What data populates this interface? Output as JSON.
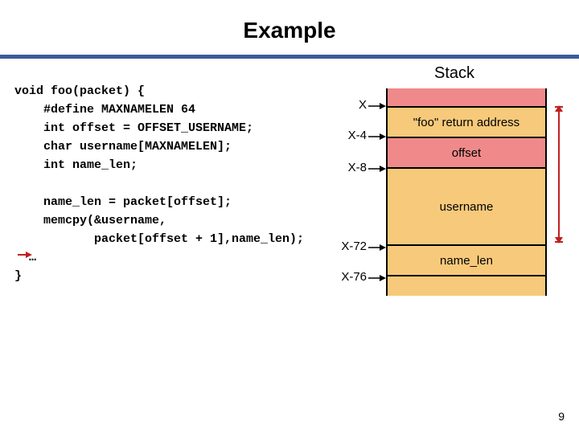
{
  "title": "Example",
  "code": {
    "l1": "void foo(packet) {",
    "l2": "    #define MAXNAMELEN 64",
    "l3": "    int offset = OFFSET_USERNAME;",
    "l4": "    char username[MAXNAMELEN];",
    "l5": "    int name_len;",
    "l6": "",
    "l7": "    name_len = packet[offset];",
    "l8": "    memcpy(&username,",
    "l9": "           packet[offset + 1],name_len);",
    "l10": "  …",
    "l11": "}"
  },
  "stack": {
    "heading": "Stack",
    "rows": {
      "retaddr": "\"foo\" return address",
      "offset": "offset",
      "username": "username",
      "namelen": "name_len"
    },
    "pointers": {
      "p0": "X",
      "p1": "X-4",
      "p2": "X-8",
      "p3": "X-72",
      "p4": "X-76"
    }
  },
  "page_number": "9"
}
